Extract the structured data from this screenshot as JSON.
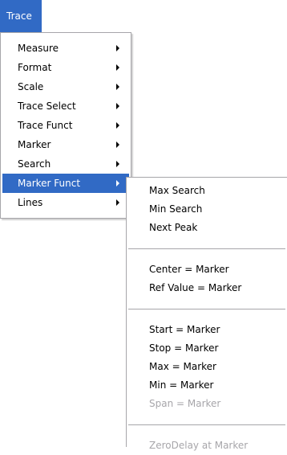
{
  "menubar": {
    "trace_label": "Trace"
  },
  "trace_menu": {
    "items": [
      {
        "label": "Measure"
      },
      {
        "label": "Format"
      },
      {
        "label": "Scale"
      },
      {
        "label": "Trace Select"
      },
      {
        "label": "Trace Funct"
      },
      {
        "label": "Marker"
      },
      {
        "label": "Search"
      },
      {
        "label": "Marker Funct"
      },
      {
        "label": "Lines"
      }
    ],
    "selected": "Marker Funct"
  },
  "marker_funct_menu": {
    "group1": [
      {
        "label": "Max Search"
      },
      {
        "label": "Min Search"
      },
      {
        "label": "Next Peak"
      }
    ],
    "group2": [
      {
        "label": "Center = Marker"
      },
      {
        "label": "Ref Value = Marker"
      }
    ],
    "group3": [
      {
        "label": "Start = Marker"
      },
      {
        "label": "Stop = Marker"
      },
      {
        "label": "Max = Marker"
      },
      {
        "label": "Min = Marker"
      },
      {
        "label": "Span = Marker"
      }
    ],
    "group4": [
      {
        "label": "ZeroDelay at Marker"
      }
    ]
  },
  "colors": {
    "highlight": "#316ac5",
    "disabled_text": "#a7a6aa",
    "border": "#a7a6aa"
  }
}
